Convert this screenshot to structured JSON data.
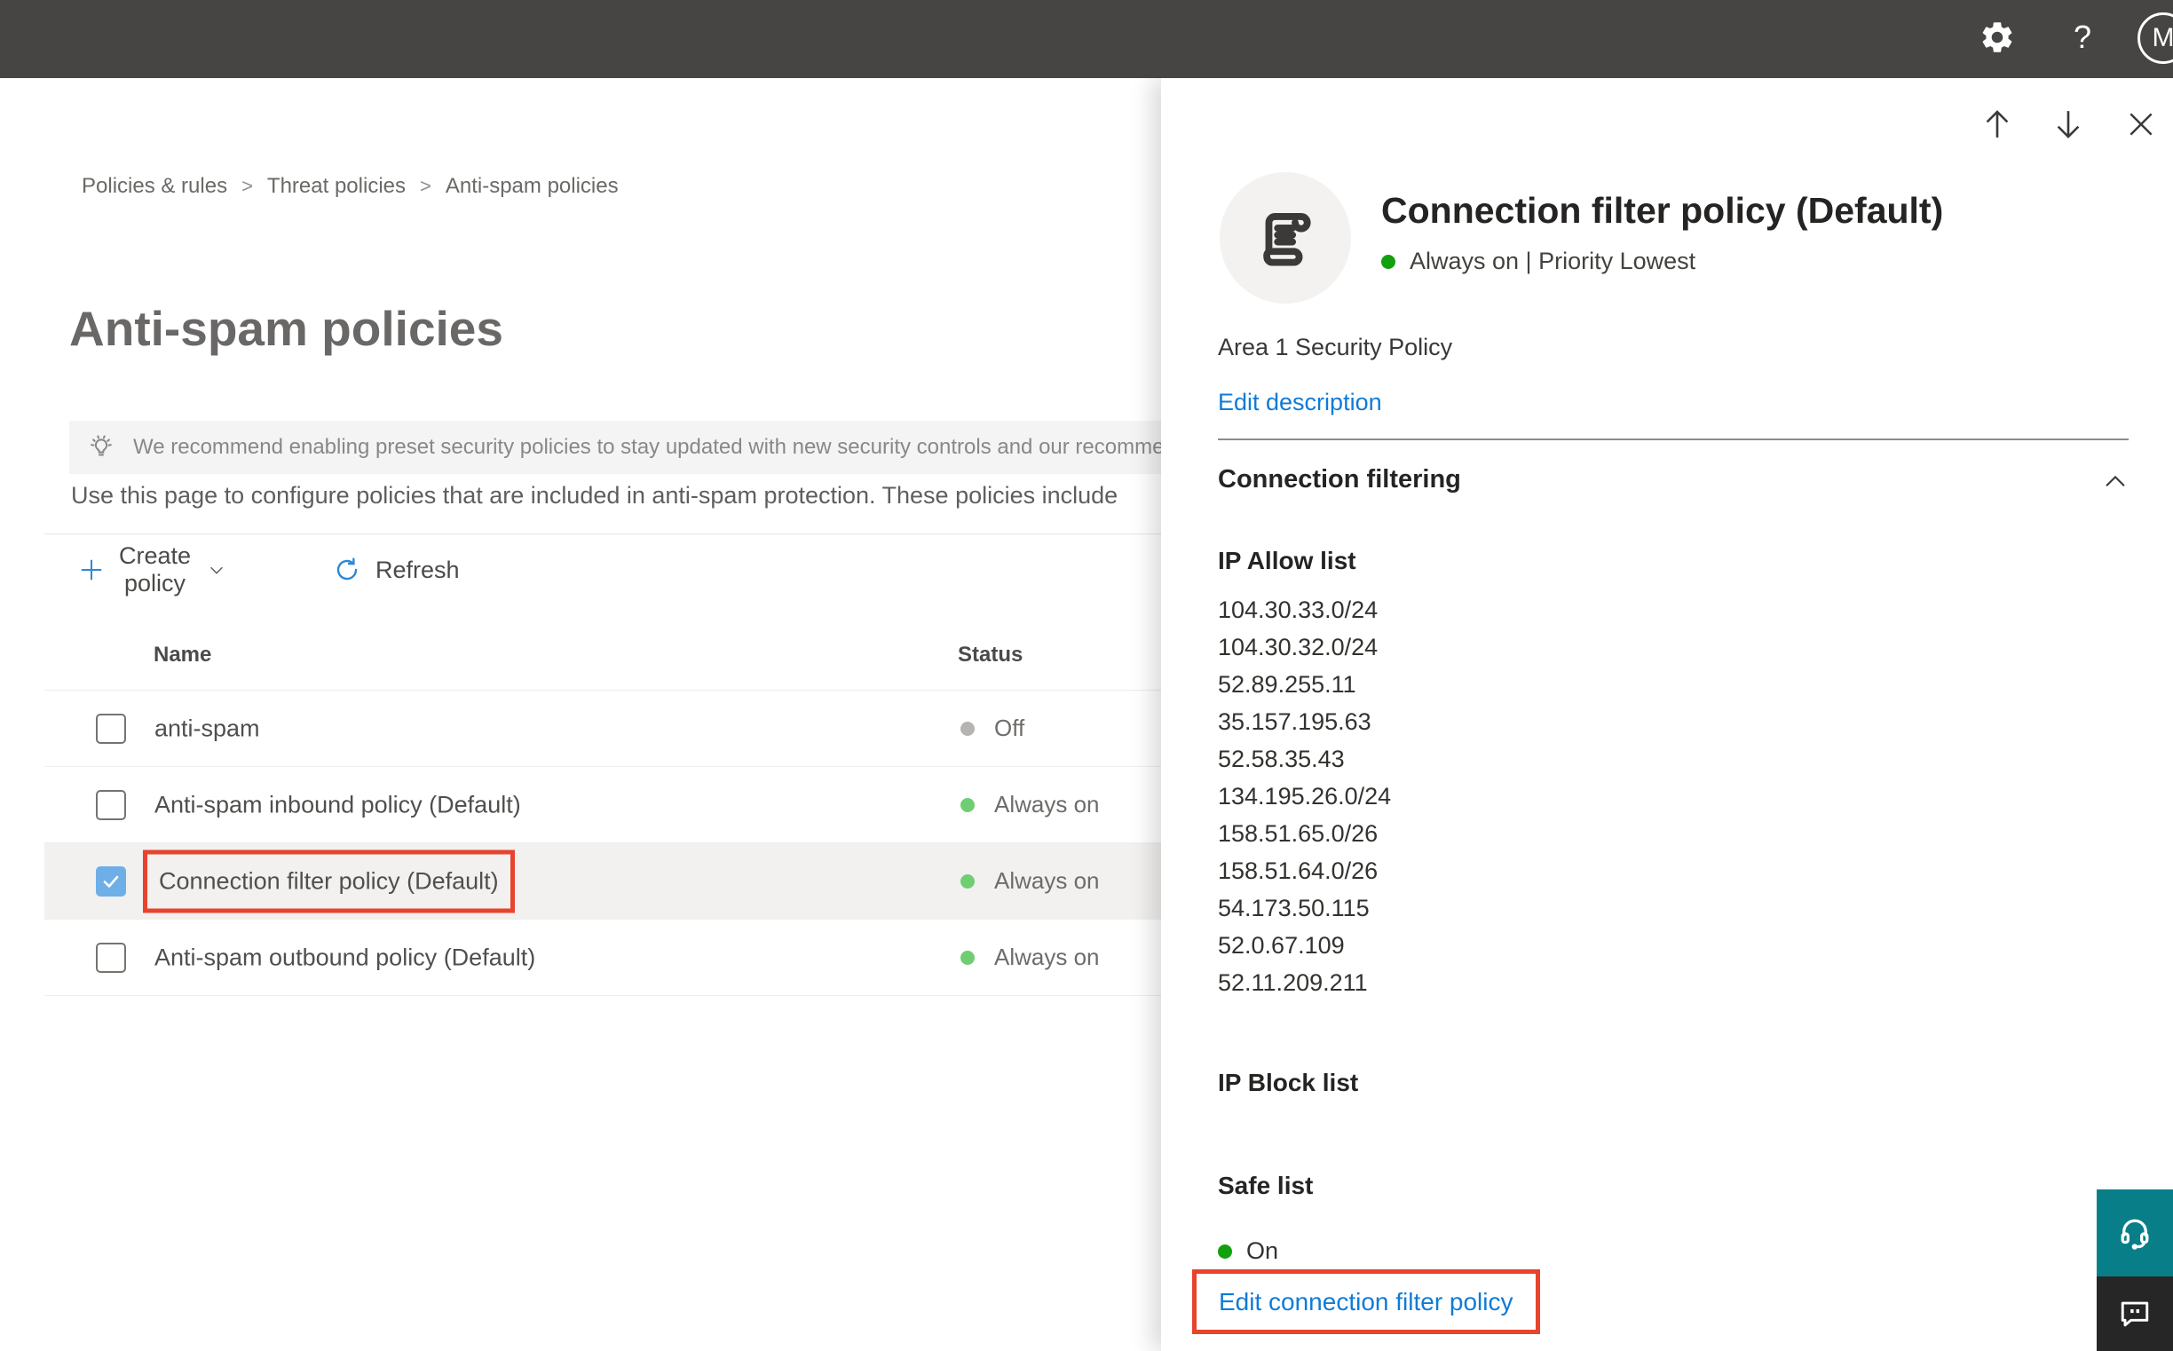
{
  "topbar": {
    "help_label": "?",
    "avatar_initial": "M"
  },
  "breadcrumb": {
    "items": [
      "Policies & rules",
      "Threat policies",
      "Anti-spam policies"
    ],
    "separator": ">"
  },
  "page": {
    "title": "Anti-spam policies",
    "banner_text": "We recommend enabling preset security policies to stay updated with new security controls and our recomme",
    "description": "Use this page to configure policies that are included in anti-spam protection. These policies include",
    "toolbar": {
      "create_policy_label": "Create policy",
      "refresh_label": "Refresh"
    }
  },
  "policy_table": {
    "columns": [
      "Name",
      "Status"
    ],
    "rows": [
      {
        "name": "anti-spam",
        "status": "Off",
        "status_color": "#b6b3b0",
        "checked": false,
        "selected": false,
        "highlighted": false
      },
      {
        "name": "Anti-spam inbound policy (Default)",
        "status": "Always on",
        "status_color": "#6fce72",
        "checked": false,
        "selected": false,
        "highlighted": false
      },
      {
        "name": "Connection filter policy (Default)",
        "status": "Always on",
        "status_color": "#6fce72",
        "checked": true,
        "selected": true,
        "highlighted": true
      },
      {
        "name": "Anti-spam outbound policy (Default)",
        "status": "Always on",
        "status_color": "#6fce72",
        "checked": false,
        "selected": false,
        "highlighted": false
      }
    ]
  },
  "flyout": {
    "title": "Connection filter policy (Default)",
    "status_line": "Always on | Priority Lowest",
    "status_dot_color": "#12a10e",
    "description": "Area 1 Security Policy",
    "edit_description_label": "Edit description",
    "section": {
      "title": "Connection filtering",
      "ip_allow": {
        "label": "IP Allow list",
        "ips": [
          "104.30.33.0/24",
          "104.30.32.0/24",
          "52.89.255.11",
          "35.157.195.63",
          "52.58.35.43",
          "134.195.26.0/24",
          "158.51.65.0/26",
          "158.51.64.0/26",
          "54.173.50.115",
          "52.0.67.109",
          "52.11.209.211"
        ]
      },
      "ip_block": {
        "label": "IP Block list"
      },
      "safe_list": {
        "label": "Safe list",
        "value": "On",
        "status_dot_color": "#12a10e"
      },
      "edit_link_label": "Edit connection filter policy"
    }
  },
  "colors": {
    "topbar_bg": "#474543",
    "accent_blue": "#2b88d8",
    "link_blue": "#0f7bd7",
    "annotation_red": "#e8432d",
    "checkbox_checked_blue": "#6fafe8",
    "table_status_green": "#6fce72",
    "flyout_status_green": "#12a10e",
    "status_gray": "#b6b3b0",
    "support_teal": "#087f88",
    "feedback_dark": "#262626"
  }
}
